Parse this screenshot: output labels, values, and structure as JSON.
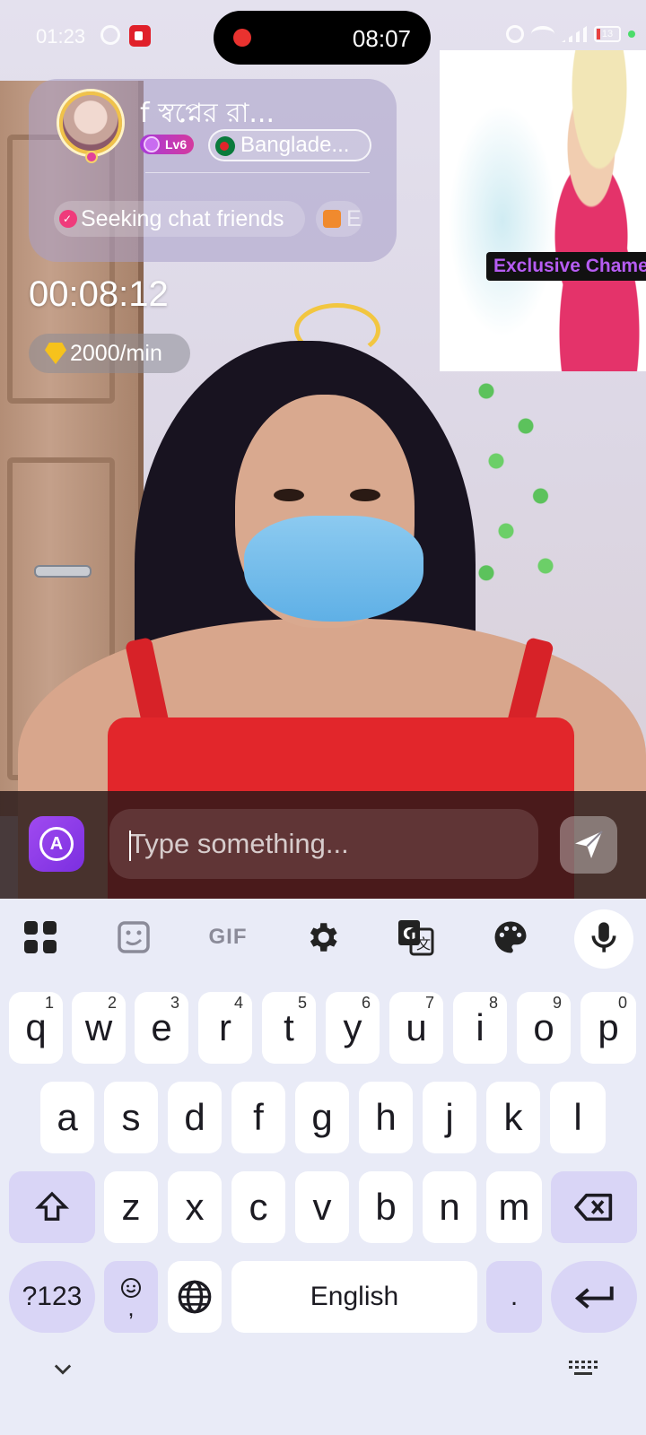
{
  "status_bar": {
    "time": "01:23",
    "call_pill_time": "08:07",
    "battery": "13"
  },
  "profile": {
    "username": "f স্বপ্নের রা...",
    "level": "Lv6",
    "country": "Banglade...",
    "tags": [
      "Seeking chat friends",
      "E"
    ]
  },
  "call": {
    "timer": "00:08:12",
    "rate": "2000/min"
  },
  "ad": {
    "label": "Exclusive Chame"
  },
  "chat_input": {
    "placeholder": "Type something..."
  },
  "keyboard": {
    "toolbar": [
      "apps-grid-icon",
      "sticker-icon",
      "gif-icon",
      "settings-gear-icon",
      "translate-icon",
      "palette-icon",
      "microphone-icon"
    ],
    "gif_label": "GIF",
    "row1": [
      {
        "key": "q",
        "hint": "1"
      },
      {
        "key": "w",
        "hint": "2"
      },
      {
        "key": "e",
        "hint": "3"
      },
      {
        "key": "r",
        "hint": "4"
      },
      {
        "key": "t",
        "hint": "5"
      },
      {
        "key": "y",
        "hint": "6"
      },
      {
        "key": "u",
        "hint": "7"
      },
      {
        "key": "i",
        "hint": "8"
      },
      {
        "key": "o",
        "hint": "9"
      },
      {
        "key": "p",
        "hint": "0"
      }
    ],
    "row2": [
      "a",
      "s",
      "d",
      "f",
      "g",
      "h",
      "j",
      "k",
      "l"
    ],
    "row3": [
      "z",
      "x",
      "c",
      "v",
      "b",
      "n",
      "m"
    ],
    "symbols_label": "?123",
    "emoji_comma": ",",
    "space_label": "English",
    "period": ".",
    "accent_color": "#d9d5f6"
  }
}
